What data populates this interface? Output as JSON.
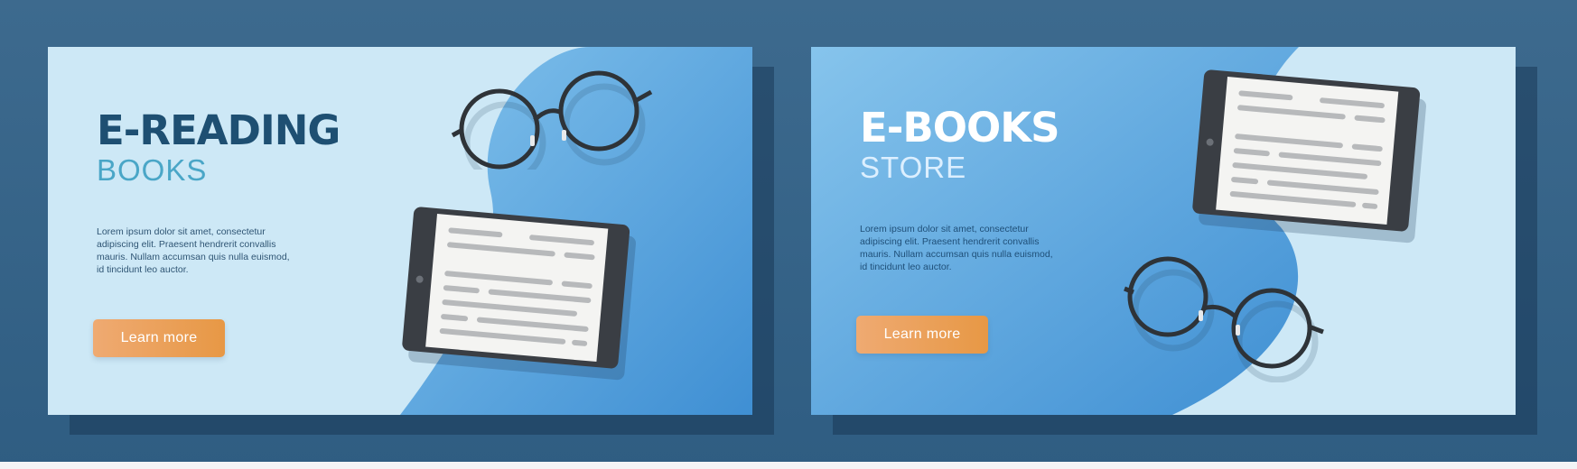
{
  "banners": [
    {
      "title": "E-READING",
      "subtitle": "BOOKS",
      "description": "Lorem ipsum dolor sit amet, consectetur adipiscing elit. Praesent hendrerit convallis mauris. Nullam accumsan quis nulla euismod, id tincidunt leo auctor.",
      "button_label": "Learn more"
    },
    {
      "title": "E-BOOKS",
      "subtitle": "STORE",
      "description": "Lorem ipsum dolor sit amet, consectetur adipiscing elit. Praesent hendrerit convallis mauris. Nullam accumsan quis nulla euismod, id tincidunt leo auctor.",
      "button_label": "Learn more"
    }
  ],
  "colors": {
    "page_background": "#35628a",
    "banner_light": "#cde8f6",
    "banner_blue": "#4d9fdd",
    "title_dark": "#1e4f72",
    "subtitle_teal": "#4aa6c7",
    "button_orange": "#eba061"
  }
}
